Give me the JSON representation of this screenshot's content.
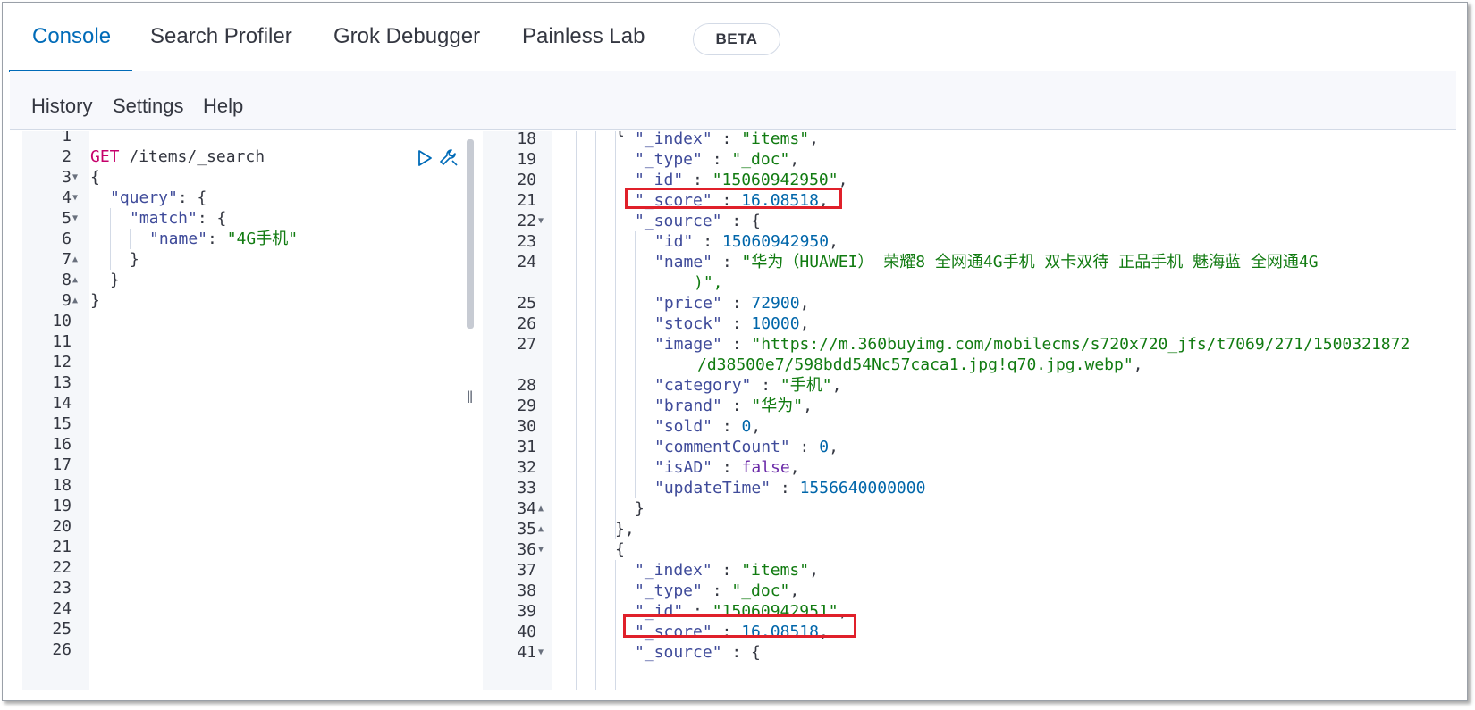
{
  "tabs": [
    {
      "label": "Console",
      "active": true
    },
    {
      "label": "Search Profiler",
      "active": false
    },
    {
      "label": "Grok Debugger",
      "active": false
    },
    {
      "label": "Painless Lab",
      "active": false
    }
  ],
  "badge": "BETA",
  "menu": [
    "History",
    "Settings",
    "Help"
  ],
  "divider_glyph": "‖",
  "request": {
    "method": "GET",
    "path": " /items/_search",
    "line_numbers": [
      "1",
      "2",
      "3",
      "4",
      "5",
      "6",
      "7",
      "8",
      "9",
      "10",
      "11",
      "12",
      "13",
      "14",
      "15",
      "16",
      "17",
      "18",
      "19",
      "20",
      "21",
      "22",
      "23",
      "24",
      "25",
      "26"
    ],
    "lines": {
      "l3": "{",
      "l4_key": "\"query\"",
      "l4_rest": ": {",
      "l5_key": "\"match\"",
      "l5_rest": ": {",
      "l6_key": "\"name\"",
      "l6_colon": ": ",
      "l6_val": "\"4G手机\"",
      "l7": "}",
      "l8": "}",
      "l9": "}"
    },
    "icons": [
      "play-icon",
      "wrench-icon"
    ]
  },
  "response": {
    "line_numbers": [
      "18",
      "19",
      "20",
      "21",
      "22",
      "23",
      "24",
      "25",
      "26",
      "27",
      "28",
      "29",
      "30",
      "31",
      "32",
      "33",
      "34",
      "35",
      "36",
      "37",
      "38",
      "39",
      "40",
      "41"
    ],
    "lines": {
      "l18_key": "\"_index\"",
      "l18_val": "\"items\"",
      "l19_key": "\"_type\"",
      "l19_val": "\"_doc\"",
      "l20_key": "\"_id\"",
      "l20_val": "\"15060942950\"",
      "l21_key": "\"_score\"",
      "l21_val": "16.08518",
      "l22_key": "\"_source\"",
      "l22_rest": " : {",
      "l23_key": "\"id\"",
      "l23_val": "15060942950",
      "l24_key": "\"name\"",
      "l24_val": "\"华为（HUAWEI） 荣耀8 全网通4G手机 双卡双待 正品手机 魅海蓝 全网通4G",
      "l24_wrap": ")\",",
      "l25_key": "\"price\"",
      "l25_val": "72900",
      "l26_key": "\"stock\"",
      "l26_val": "10000",
      "l27_key": "\"image\"",
      "l27_val": "\"https://m.360buyimg.com/mobilecms/s720x720_jfs/t7069/271/1500321872",
      "l27_wrap": "/d38500e7/598bdd54Nc57caca1.jpg!q70.jpg.webp\"",
      "l28_key": "\"category\"",
      "l28_val": "\"手机\"",
      "l29_key": "\"brand\"",
      "l29_val": "\"华为\"",
      "l30_key": "\"sold\"",
      "l30_val": "0",
      "l31_key": "\"commentCount\"",
      "l31_val": "0",
      "l32_key": "\"isAD\"",
      "l32_val": "false",
      "l33_key": "\"updateTime\"",
      "l33_val": "1556640000000",
      "l34": "}",
      "l35": "},",
      "l36": "{",
      "l37_key": "\"_index\"",
      "l37_val": "\"items\"",
      "l38_key": "\"_type\"",
      "l38_val": "\"_doc\"",
      "l39_key": "\"_id\"",
      "l39_val": "\"15060942951\"",
      "l40_key": "\"_score\"",
      "l40_val": "16.08518",
      "l41_key": "\"_source\"",
      "l41_rest": " : {"
    }
  },
  "colors": {
    "accent": "#006bb8",
    "string": "#117b11",
    "method": "#c6006b",
    "number": "#0066aa",
    "highlight": "#e0202a"
  }
}
